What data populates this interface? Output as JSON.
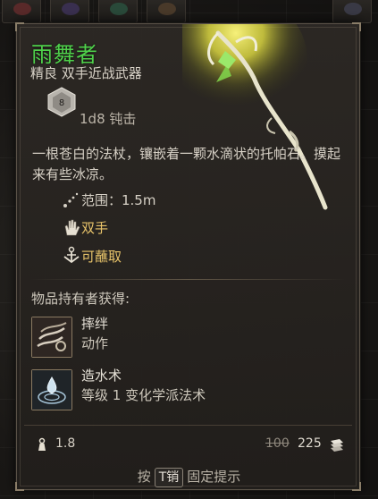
{
  "item": {
    "name": "雨舞者",
    "rarity_type": "精良 双手近战武器",
    "damage_die": "8",
    "damage": "1d8 钝击",
    "description": "一根苍白的法杖，镶嵌着一颗水滴状的托帕石。摸起来有些冰凉。",
    "properties": [
      {
        "icon": "range-icon",
        "label": "范围：1.5m"
      },
      {
        "icon": "two-hands-icon",
        "label": "双手"
      },
      {
        "icon": "dippable-icon",
        "label": "可蘸取"
      }
    ]
  },
  "grants": {
    "title": "物品持有者获得:",
    "abilities": [
      {
        "icon": "topple-action-icon",
        "name": "摔绊",
        "type": "动作"
      },
      {
        "icon": "create-water-icon",
        "name": "造水术",
        "type": "等级 1 变化学派法术"
      }
    ]
  },
  "footer": {
    "weight": "1.8",
    "price_old": "100",
    "price": "225"
  },
  "hint": {
    "prefix": "按",
    "key": "T",
    "key_suffix": "销",
    "suffix": "固定提示"
  },
  "colors": {
    "title_green": "#4fd14b",
    "gold_text": "#e8c46a",
    "panel_bg": "#2c2824"
  }
}
